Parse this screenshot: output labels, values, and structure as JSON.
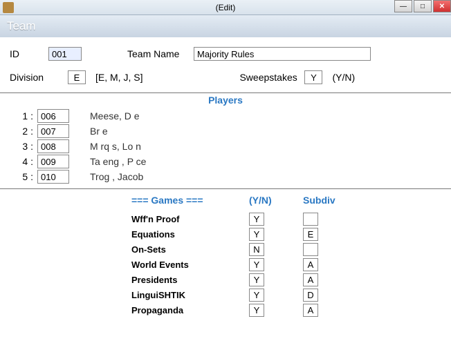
{
  "window": {
    "title": "(Edit)"
  },
  "section_header": "Team",
  "labels": {
    "id": "ID",
    "team_name": "Team Name",
    "division": "Division",
    "division_hint": "[E, M, J, S]",
    "sweepstakes": "Sweepstakes",
    "sweeps_hint": "(Y/N)",
    "players": "Players",
    "games_header": "===  Games  ===",
    "yn_header": "(Y/N)",
    "subdiv_header": "Subdiv"
  },
  "values": {
    "id": "001",
    "team_name": "Majority Rules",
    "division": "E",
    "sweepstakes": "Y"
  },
  "players": [
    {
      "idx": "1 :",
      "id": "006",
      "name": "Meese, D  e"
    },
    {
      "idx": "2 :",
      "id": "007",
      "name": "        Br    e"
    },
    {
      "idx": "3 :",
      "id": "008",
      "name": "M rq s, Lo  n"
    },
    {
      "idx": "4 :",
      "id": "009",
      "name": "Ta eng  , P  ce"
    },
    {
      "idx": "5 :",
      "id": "010",
      "name": "Trog    , Jacob"
    }
  ],
  "games": [
    {
      "name": "Wff'n Proof",
      "yn": "Y",
      "sub": ""
    },
    {
      "name": "Equations",
      "yn": "Y",
      "sub": "E"
    },
    {
      "name": "On-Sets",
      "yn": "N",
      "sub": ""
    },
    {
      "name": "World Events",
      "yn": "Y",
      "sub": "A"
    },
    {
      "name": "Presidents",
      "yn": "Y",
      "sub": "A"
    },
    {
      "name": "LinguiSHTIK",
      "yn": "Y",
      "sub": "D"
    },
    {
      "name": "Propaganda",
      "yn": "Y",
      "sub": "A"
    }
  ]
}
